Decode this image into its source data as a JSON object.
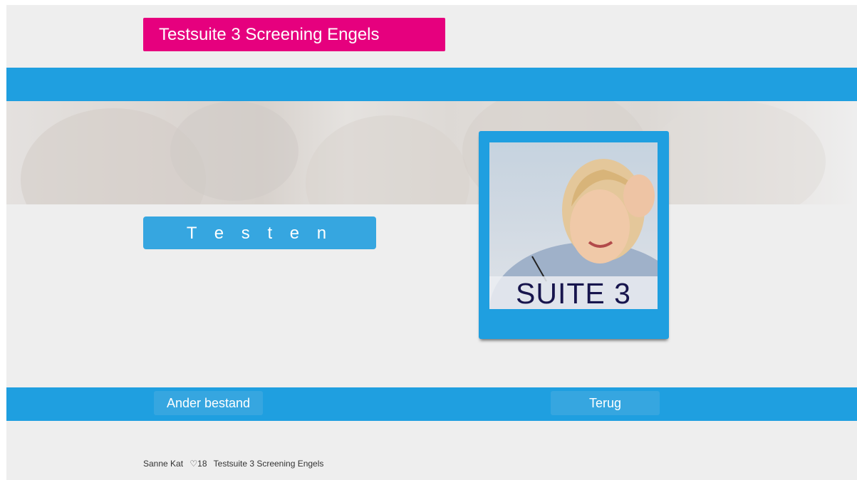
{
  "header": {
    "title": "Testsuite 3 Screening Engels"
  },
  "main": {
    "testen_label": "T e s t e n",
    "suite_card": {
      "label": "SUITE 3"
    }
  },
  "actions": {
    "ander_bestand_label": "Ander bestand",
    "terug_label": "Terug"
  },
  "footer": {
    "user": "Sanne Kat",
    "heart_icon": "♡",
    "count": "18",
    "suite_name": "Testsuite 3 Screening Engels"
  },
  "colors": {
    "accent_pink": "#e6007e",
    "band_blue": "#1f9fe0",
    "button_blue": "#36a6e0",
    "background": "#eeeeee"
  }
}
